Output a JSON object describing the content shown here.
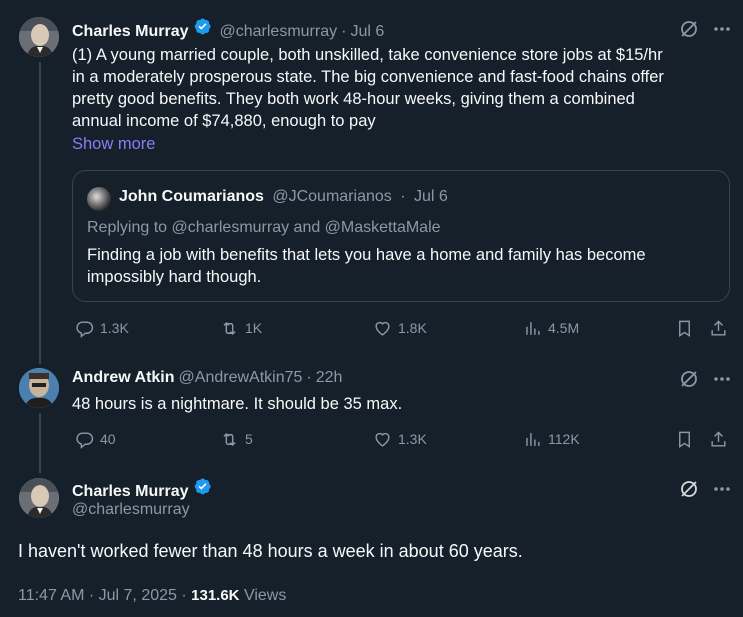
{
  "tweet1": {
    "name": "Charles Murray",
    "handle": "@charlesmurray",
    "time": "Jul 6",
    "text_lines": [
      "(1) A young married couple, both unskilled, take convenience store jobs at $15/hr",
      "in a moderately prosperous state. The big convenience and fast-food chains offer",
      "pretty good benefits. They both  work 48-hour weeks, giving them a combined",
      "annual income of $74,880, enough to pay"
    ],
    "show_more": "Show more",
    "quote": {
      "name": "John Coumarianos",
      "handle": "@JCoumarianos",
      "time": "Jul 6",
      "replying": "Replying to @charlesmurray and @MaskettaMale",
      "text_lines": [
        "Finding a job with benefits that lets you have a home and family has become",
        "impossibly hard though."
      ]
    },
    "stats": {
      "replies": "1.3K",
      "reposts": "1K",
      "likes": "1.8K",
      "views": "4.5M"
    }
  },
  "tweet2": {
    "name": "Andrew Atkin",
    "handle": "@AndrewAtkin75",
    "time": "22h",
    "text": "48 hours is a nightmare. It should be 35 max.",
    "stats": {
      "replies": "40",
      "reposts": "5",
      "likes": "1.3K",
      "views": "112K"
    }
  },
  "tweet3": {
    "name": "Charles Murray",
    "handle": "@charlesmurray",
    "text": "I haven't worked fewer than 48 hours a week in about 60 years.",
    "timestamp": "11:47 AM · Jul 7, 2025 · ",
    "views_count": "131.6K",
    "views_label": "Views"
  },
  "colors": {
    "background": "#15202b",
    "verified": "#1d9bf0",
    "link": "#8b7cf6",
    "muted": "#8b98a5"
  },
  "separator": "·"
}
